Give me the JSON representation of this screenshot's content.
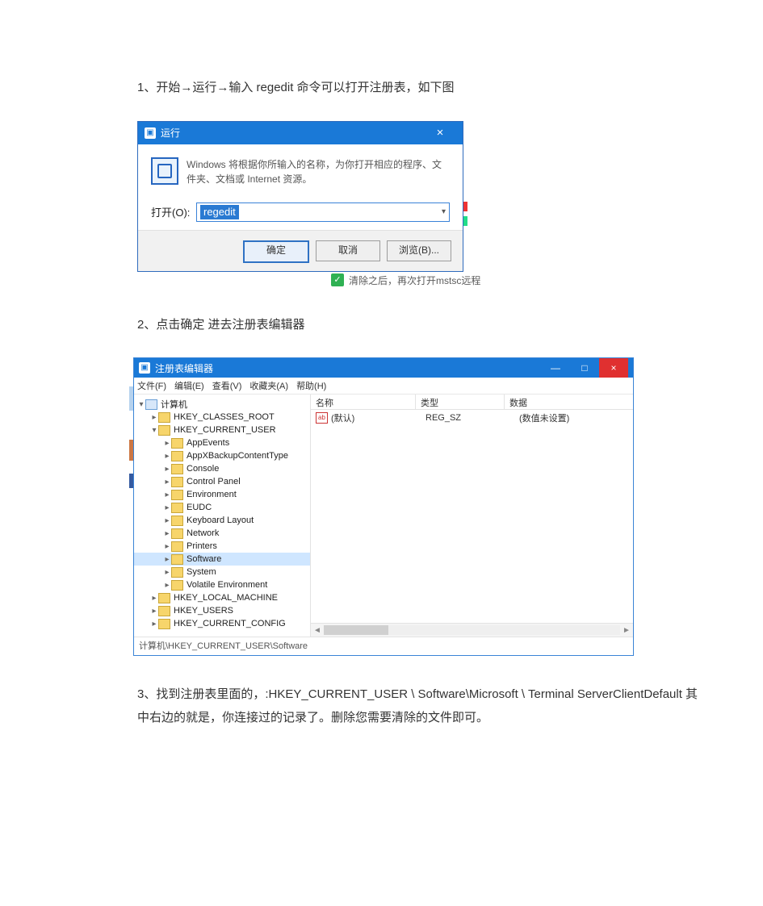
{
  "steps": {
    "s1": "1、开始→运行→输入 regedit 命令可以打开注册表，如下图",
    "s2": "2、点击确定 进去注册表编辑器",
    "s3": "3、找到注册表里面的，:HKEY_CURRENT_USER \\ Software\\Microsoft \\ Terminal ServerClientDefault  其中右边的就是，你连接过的记录了。删除您需要清除的文件即可。"
  },
  "run_dialog": {
    "title": "运行",
    "close_x": "×",
    "description": "Windows 将根据你所输入的名称，为你打开相应的程序、文件夹、文档或 Internet 资源。",
    "open_label": "打开(O):",
    "open_value": "regedit",
    "btn_ok": "确定",
    "btn_cancel": "取消",
    "btn_browse": "浏览(B)...",
    "under_caption": "清除之后，再次打开mstsc远程"
  },
  "regedit": {
    "title": "注册表编辑器",
    "win_min": "—",
    "win_max": "□",
    "win_close": "×",
    "menu": [
      "文件(F)",
      "编辑(E)",
      "查看(V)",
      "收藏夹(A)",
      "帮助(H)"
    ],
    "columns": {
      "name": "名称",
      "type": "类型",
      "data": "数据"
    },
    "default_row": {
      "name": "(默认)",
      "type": "REG_SZ",
      "data": "(数值未设置)"
    },
    "status_path": "计算机\\HKEY_CURRENT_USER\\Software",
    "tree": {
      "root": "计算机",
      "hkeys": [
        {
          "label": "HKEY_CLASSES_ROOT",
          "expanded": false,
          "indent": 1
        },
        {
          "label": "HKEY_CURRENT_USER",
          "expanded": true,
          "indent": 1
        },
        {
          "label": "AppEvents",
          "indent": 2
        },
        {
          "label": "AppXBackupContentType",
          "indent": 2
        },
        {
          "label": "Console",
          "indent": 2
        },
        {
          "label": "Control Panel",
          "indent": 2
        },
        {
          "label": "Environment",
          "indent": 2
        },
        {
          "label": "EUDC",
          "indent": 2
        },
        {
          "label": "Keyboard Layout",
          "indent": 2
        },
        {
          "label": "Network",
          "indent": 2
        },
        {
          "label": "Printers",
          "indent": 2
        },
        {
          "label": "Software",
          "indent": 2,
          "selected": true
        },
        {
          "label": "System",
          "indent": 2
        },
        {
          "label": "Volatile Environment",
          "indent": 2
        },
        {
          "label": "HKEY_LOCAL_MACHINE",
          "expanded": false,
          "indent": 1
        },
        {
          "label": "HKEY_USERS",
          "expanded": false,
          "indent": 1
        },
        {
          "label": "HKEY_CURRENT_CONFIG",
          "expanded": false,
          "indent": 1
        }
      ]
    }
  }
}
